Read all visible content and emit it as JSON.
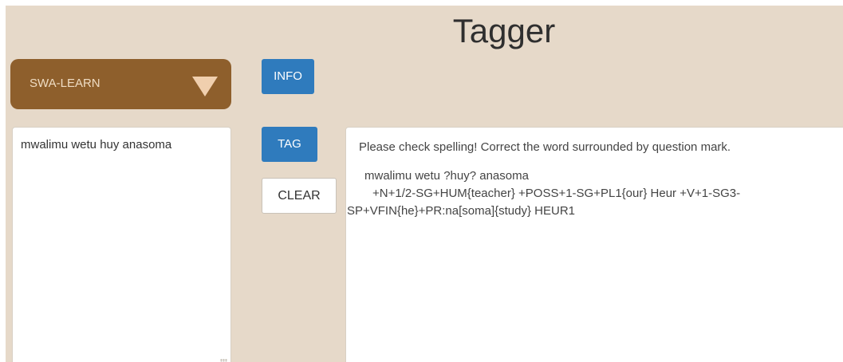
{
  "app": {
    "title": "Tagger"
  },
  "language_select": {
    "value": "SWA-LEARN"
  },
  "buttons": {
    "info": "INFO",
    "tag": "TAG",
    "clear": "CLEAR"
  },
  "input": {
    "text": "mwalimu wetu huy anasoma"
  },
  "output": {
    "message": "Please check spelling! Correct the word surrounded by question mark.",
    "sentence": "mwalimu wetu ?huy? anasoma",
    "analysis": "+N+1/2-SG+HUM{teacher} +POSS+1-SG+PL1{our} Heur +V+1-SG3-SP+VFIN{he}+PR:na[soma]{study}  HEUR1"
  },
  "colors": {
    "background": "#e6d9c9",
    "select": "#8e5f2c",
    "button_blue": "#2f7bbd"
  }
}
